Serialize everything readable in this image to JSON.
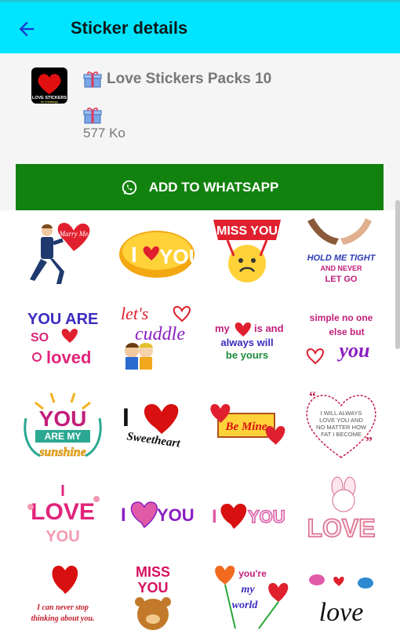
{
  "appbar": {
    "title": "Sticker details",
    "color": "#00e5ff"
  },
  "pack": {
    "name": "Love Stickers Packs 10",
    "size": "577 Ko",
    "icon_text": "LOVE STICKERS",
    "icon_subtext": "for WhatsApp"
  },
  "button": {
    "label": "ADD TO WHATSAPP",
    "color": "#12820e",
    "icon": "whatsapp-icon"
  },
  "stickers": [
    {
      "name": "marry-me-sticker",
      "text": "Marry Me"
    },
    {
      "name": "i-love-you-gold-sticker",
      "text": "I YOU"
    },
    {
      "name": "miss-you-sticker",
      "text": "MISS YOU"
    },
    {
      "name": "hold-me-tight-sticker",
      "text": "HOLD ME TIGHT AND NEVER LET GO"
    },
    {
      "name": "you-are-so-loved-sticker",
      "text": "YOU ARE SO loved"
    },
    {
      "name": "lets-cuddle-sticker",
      "text": "let's cuddle"
    },
    {
      "name": "my-heart-is-yours-sticker",
      "text": "my is and always will be yours"
    },
    {
      "name": "simple-no-one-sticker",
      "text": "simple no one else but you"
    },
    {
      "name": "you-are-my-sunshine-sticker",
      "text": "YOU ARE MY sunshine"
    },
    {
      "name": "i-love-sweetheart-sticker",
      "text": "I Sweetheart"
    },
    {
      "name": "be-mine-sticker",
      "text": "Be Mine"
    },
    {
      "name": "i-will-always-love-you-sticker",
      "text": "I WILL ALWAYS LOVE YOU AND NO MATTER HOW FAT I BECOME"
    },
    {
      "name": "i-love-you-floral-sticker",
      "text": "I LOVE YOU"
    },
    {
      "name": "i-love-you-pink-sticker",
      "text": "I YOU"
    },
    {
      "name": "i-love-you-red-sticker",
      "text": "I YOU"
    },
    {
      "name": "love-bunny-sticker",
      "text": "LOVE"
    },
    {
      "name": "never-stop-thinking-sticker",
      "text": "I can never stop thinking about you."
    },
    {
      "name": "miss-you-bear-sticker",
      "text": "MISS YOU"
    },
    {
      "name": "youre-my-world-sticker",
      "text": "you're my world"
    },
    {
      "name": "love-birds-sticker",
      "text": "love"
    }
  ]
}
